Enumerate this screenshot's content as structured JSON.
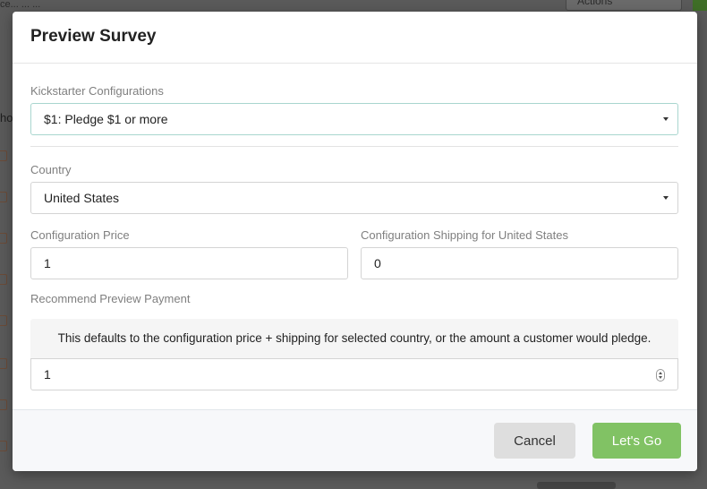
{
  "background": {
    "top_left_text": "ce... ... ...",
    "actions_label": "Actions",
    "partial_text": "ho"
  },
  "modal": {
    "title": "Preview Survey",
    "kickstarter": {
      "label": "Kickstarter Configurations",
      "selected": "$1: Pledge $1 or more"
    },
    "country": {
      "label": "Country",
      "selected": "United States"
    },
    "config_price": {
      "label": "Configuration Price",
      "value": "1"
    },
    "config_shipping": {
      "label": "Configuration Shipping for United States",
      "value": "0"
    },
    "recommend": {
      "label": "Recommend Preview Payment",
      "note": "This defaults to the configuration price + shipping for selected country, or the amount a customer would pledge.",
      "value": "1"
    },
    "footer": {
      "cancel_label": "Cancel",
      "go_label": "Let's Go"
    }
  },
  "colors": {
    "accent_green": "#81c264",
    "focus_border": "#a9d6cf",
    "overlay": "#5a5a5a"
  }
}
